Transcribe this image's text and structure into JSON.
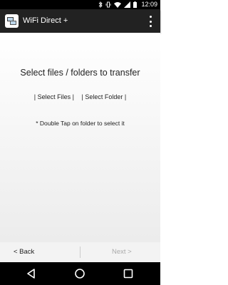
{
  "status_bar": {
    "time": "12:09",
    "icons": [
      "bluetooth-icon",
      "vibrate-icon",
      "wifi-icon",
      "signal-icon",
      "battery-icon"
    ]
  },
  "app_bar": {
    "title": "WiFi Direct +",
    "icon": "app-icon",
    "menu_icon": "overflow-menu-icon"
  },
  "main": {
    "headline": "Select files / folders to transfer",
    "select_files_label": "| Select Files |",
    "select_folder_label": "| Select Folder |",
    "hint": "* Double Tap on folder to select it"
  },
  "bottom_bar": {
    "back_label": "< Back",
    "next_label": "Next >"
  },
  "nav_bar": {
    "icons": [
      "back-triangle-icon",
      "home-circle-icon",
      "recents-square-icon"
    ]
  },
  "colors": {
    "status_bar": "#000000",
    "app_bar": "#222222",
    "text": "#222222",
    "disabled_text": "#aaaaaa"
  }
}
